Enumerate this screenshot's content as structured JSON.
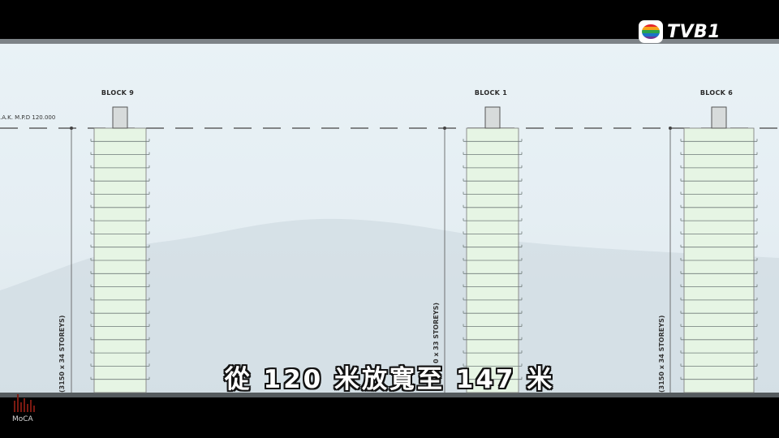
{
  "broadcaster": {
    "logo_text": "TVB1"
  },
  "corner_logo": {
    "text": "MoCA"
  },
  "drawing": {
    "level_label": ".A.K. M.P.D 120.000",
    "blocks": [
      {
        "label": "BLOCK 9",
        "dimension": "(3150 x 34 STOREYS)"
      },
      {
        "label": "BLOCK 1",
        "dimension": "0 x 33 STOREYS)"
      },
      {
        "label": "BLOCK 6",
        "dimension": "(3150 x 34 STOREYS)"
      }
    ]
  },
  "subtitle": {
    "text": "從 120 米放寬至 147 米"
  },
  "colors": {
    "tower_fill": "#e6f5e4",
    "background_sky": "#e9f2f6",
    "letterbox": "#000000"
  }
}
